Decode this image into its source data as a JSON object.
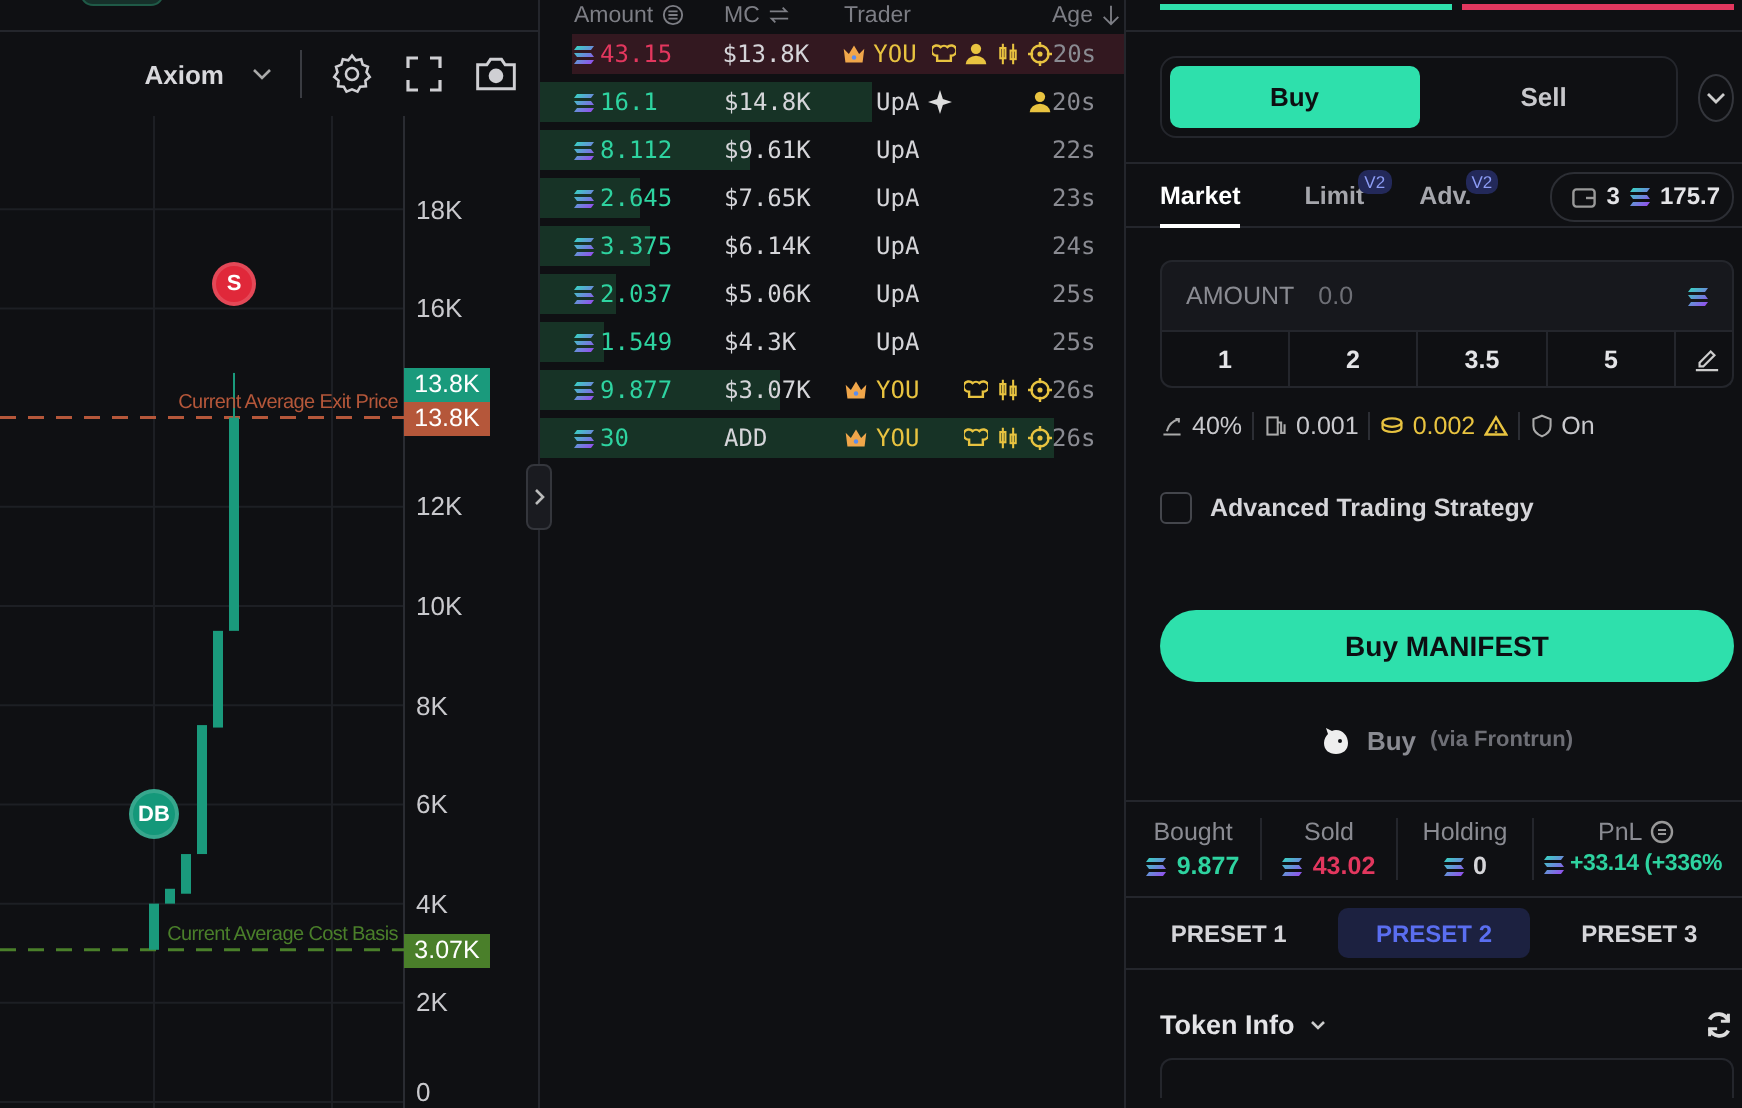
{
  "chart_toolbar": {
    "source": "Axiom"
  },
  "price_chart": {
    "axis_labels": [
      "18K",
      "16K",
      "12K",
      "10K",
      "8K",
      "6K",
      "4K",
      "2K",
      "0"
    ],
    "markers": [
      {
        "kind": "sell",
        "text": "S"
      },
      {
        "kind": "buy",
        "text": "DB"
      }
    ],
    "price_lines": [
      {
        "kind": "exit",
        "label": "Current Average Exit Price",
        "tag": "13.8K"
      },
      {
        "kind": "cost",
        "label": "Current Average Cost Basis",
        "tag": "3.07K"
      }
    ],
    "last_price": {
      "tag": "13.8K"
    }
  },
  "trades": {
    "columns": [
      "Amount",
      "MC",
      "Trader",
      "Age"
    ],
    "rows": [
      {
        "kind": "sell",
        "amount": "43.15",
        "level": 1,
        "mc": "$13.8K",
        "crown": true,
        "trader": "YOU",
        "sparkle": false,
        "badges": [
          {
            "kind": "chef"
          },
          {
            "kind": "person"
          },
          {
            "kind": "candles"
          },
          {
            "kind": "target"
          }
        ],
        "age": "20s"
      },
      {
        "kind": "buy",
        "amount": "16.1",
        "level": 0.57,
        "mc": "$14.8K",
        "crown": false,
        "trader": "UpA",
        "sparkle": true,
        "badges": [
          {
            "kind": "person"
          }
        ],
        "age": "20s"
      },
      {
        "kind": "buy",
        "amount": "8.112",
        "level": 0.36,
        "mc": "$9.61K",
        "crown": false,
        "trader": "UpA",
        "sparkle": false,
        "age": "22s"
      },
      {
        "kind": "buy",
        "amount": "2.645",
        "level": 0.17,
        "mc": "$7.65K",
        "crown": false,
        "trader": "UpA",
        "sparkle": false,
        "age": "23s"
      },
      {
        "kind": "buy",
        "amount": "3.375",
        "level": 0.19,
        "mc": "$6.14K",
        "crown": false,
        "trader": "UpA",
        "sparkle": false,
        "age": "24s"
      },
      {
        "kind": "buy",
        "amount": "2.037",
        "level": 0.13,
        "mc": "$5.06K",
        "crown": false,
        "trader": "UpA",
        "sparkle": false,
        "age": "25s"
      },
      {
        "kind": "buy",
        "amount": "1.549",
        "level": 0.11,
        "mc": "$4.3K",
        "crown": false,
        "trader": "UpA",
        "sparkle": false,
        "age": "25s"
      },
      {
        "kind": "buy",
        "amount": "9.877",
        "level": 0.41,
        "mc": "$3.07K",
        "crown": true,
        "trader": "YOU",
        "sparkle": false,
        "badges": [
          {
            "kind": "chef"
          },
          {
            "kind": "candles"
          },
          {
            "kind": "target"
          }
        ],
        "age": "26s"
      },
      {
        "kind": "buy",
        "amount": "30",
        "level": 0.88,
        "mc": "ADD",
        "crown": true,
        "trader": "YOU",
        "sparkle": false,
        "badges": [
          {
            "kind": "chef"
          },
          {
            "kind": "candles"
          },
          {
            "kind": "target"
          }
        ],
        "age": "26s"
      }
    ]
  },
  "trade_panel": {
    "pressure": {
      "level": 0.51
    },
    "sides": [
      {
        "label": "Buy",
        "selected": true
      },
      {
        "label": "Sell",
        "selected": false
      }
    ],
    "order_tabs": [
      {
        "label": "Market",
        "selected": true
      },
      {
        "label": "Limit",
        "selected": false,
        "badge": "V2"
      },
      {
        "label": "Adv.",
        "selected": false,
        "badge": "V2"
      }
    ],
    "wallet": {
      "count": "3",
      "balance": "175.7"
    },
    "amount": {
      "label": "AMOUNT",
      "placeholder": "0.0"
    },
    "quick_amounts": [
      "1",
      "2",
      "3.5",
      "5"
    ],
    "settings": [
      {
        "kind": "slippage",
        "value": "40%",
        "warning": false
      },
      {
        "kind": "gas",
        "value": "0.001",
        "warning": false
      },
      {
        "kind": "tip",
        "value": "0.002",
        "warning": true
      },
      {
        "kind": "shield",
        "value": "On",
        "warning": false
      }
    ],
    "advanced": {
      "label": "Advanced Trading Strategy",
      "checked": false
    },
    "buy_button": "Buy MANIFEST",
    "frontrun": {
      "label": "Buy",
      "note": "(via Frontrun)"
    },
    "stats": [
      {
        "kind": "up",
        "label": "Bought",
        "value": "9.877",
        "info": false
      },
      {
        "kind": "down",
        "label": "Sold",
        "value": "43.02",
        "info": false
      },
      {
        "kind": "neutral",
        "label": "Holding",
        "value": "0",
        "info": false
      },
      {
        "kind": "up",
        "label": "PnL",
        "value": "+33.14 (+336%",
        "info": true
      }
    ],
    "presets": [
      {
        "label": "PRESET 1",
        "selected": false
      },
      {
        "label": "PRESET 2",
        "selected": true
      },
      {
        "label": "PRESET 3",
        "selected": false
      }
    ],
    "token_info": {
      "title": "Token Info"
    }
  }
}
